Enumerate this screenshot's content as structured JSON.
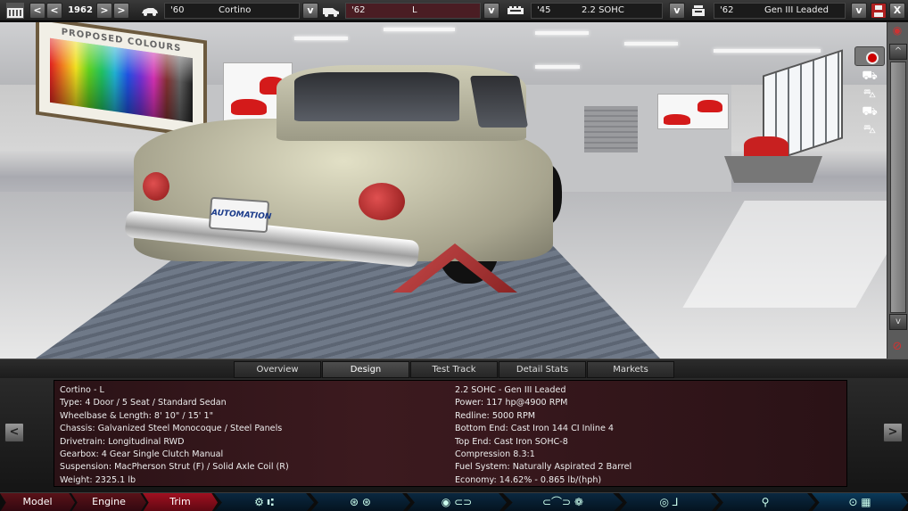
{
  "topbar": {
    "year": "1962",
    "prev_prev": "<",
    "prev": "<",
    "next": ">",
    "next_next": ">",
    "model": {
      "year": "'60",
      "name": "Cortino",
      "dropdown": "v"
    },
    "trim": {
      "year": "'62",
      "name": "L",
      "dropdown": "v"
    },
    "engine": {
      "year": "'45",
      "name": "2.2 SOHC",
      "dropdown": "v"
    },
    "fuel": {
      "year": "'62",
      "name": "Gen III Leaded",
      "dropdown": "v"
    },
    "close": "X"
  },
  "viewport": {
    "poster_title": "PROPOSED COLOURS",
    "plate_text": "AUTOMATION"
  },
  "scroll": {
    "up": "^",
    "down": "v"
  },
  "tabs": [
    {
      "label": "Overview",
      "active": false
    },
    {
      "label": "Design",
      "active": true
    },
    {
      "label": "Test Track",
      "active": false
    },
    {
      "label": "Detail Stats",
      "active": false
    },
    {
      "label": "Markets",
      "active": false
    }
  ],
  "info": {
    "left": [
      "Cortino - L",
      "Type: 4 Door / 5 Seat / Standard Sedan",
      "Wheelbase & Length: 8' 10\" / 15' 1\"",
      "Chassis: Galvanized Steel Monocoque / Steel Panels",
      "Drivetrain: Longitudinal RWD",
      "Gearbox: 4 Gear Single Clutch Manual",
      "Suspension: MacPherson Strut (F) / Solid Axle Coil (R)",
      "Weight: 2325.1 lb"
    ],
    "right": [
      "2.2 SOHC - Gen III Leaded",
      "Power: 117 hp@4900 RPM",
      "Redline: 5000 RPM",
      "Bottom End: Cast Iron 144 CI Inline 4",
      "Top End: Cast Iron SOHC-8",
      "Compression 8.3:1",
      "Fuel System: Naturally Aspirated 2 Barrel",
      "Economy: 14.62% - 0.865 lb/(hph)"
    ],
    "prev_arrow": "<",
    "next_arrow": ">"
  },
  "bottomnav": {
    "main": [
      {
        "label": "Model",
        "active": false
      },
      {
        "label": "Engine",
        "active": false
      },
      {
        "label": "Trim",
        "active": true
      }
    ],
    "sub_icons": [
      "⚙ ⑆",
      "⊛ ⊛",
      "◉ ⊂⊃",
      "⊂⌒⊃ ❁",
      "◎ ⅃",
      "⚲",
      "⊙ ▦"
    ]
  }
}
